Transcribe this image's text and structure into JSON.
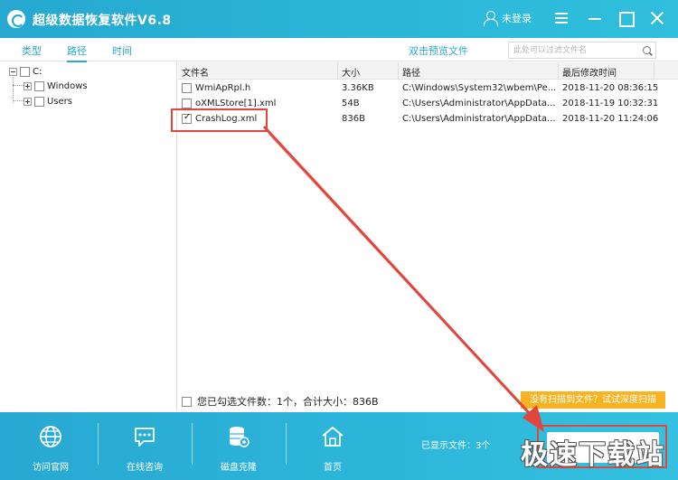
{
  "titlebar": {
    "app_title": "超级数据恢复软件V6.8",
    "login_label": "未登录",
    "brand_color": "#2aa6cf"
  },
  "tabs": [
    {
      "label": "类型",
      "active": false
    },
    {
      "label": "路径",
      "active": true
    },
    {
      "label": "时间",
      "active": false
    }
  ],
  "toolbar": {
    "preview_label": "双击预览文件",
    "filter_placeholder": "此处可以过滤文件名"
  },
  "tree": {
    "root_label": "C:",
    "children": [
      {
        "label": "Windows",
        "checked": false
      },
      {
        "label": "Users",
        "checked": false
      }
    ]
  },
  "table": {
    "columns": [
      "文件名",
      "大小",
      "路径",
      "最后修改时间"
    ],
    "rows": [
      {
        "name": "WmiApRpl.h",
        "size": "3.36KB",
        "path": "C:\\Windows\\System32\\wbem\\Pe...",
        "time": "2018-11-20 08:36:15",
        "checked": false
      },
      {
        "name": "oXMLStore[1].xml",
        "size": "54B",
        "path": "C:\\Users\\Administrator\\AppData...",
        "time": "2018-11-19 10:32:31",
        "checked": false
      },
      {
        "name": "CrashLog.xml",
        "size": "836B",
        "path": "C:\\Users\\Administrator\\AppData...",
        "time": "2018-11-20 11:24:06",
        "checked": true
      }
    ]
  },
  "status": {
    "selected_text": "您已勾选文件数：1个，合计大小：836B",
    "deep_scan_label": "没有扫描到文件？试试深度扫描",
    "deep_scan_color": "#f7b321"
  },
  "bottom": {
    "nav": [
      {
        "label": "访问官网",
        "icon": "globe-icon"
      },
      {
        "label": "在线咨询",
        "icon": "chat-icon"
      },
      {
        "label": "磁盘克隆",
        "icon": "disk-clone-icon"
      },
      {
        "label": "首页",
        "icon": "home-icon"
      }
    ],
    "shown_count": "已显示文件：3个",
    "watermark": "极速下载站"
  },
  "annotation_color": "#e0463c"
}
